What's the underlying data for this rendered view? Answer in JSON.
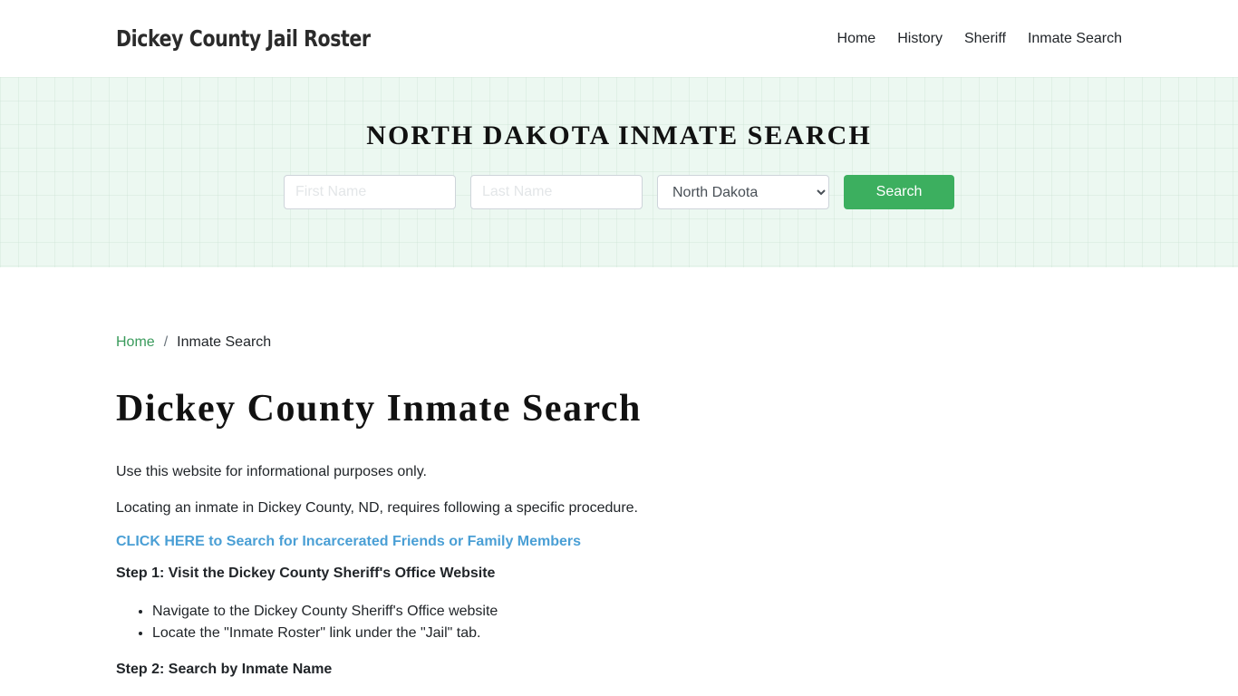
{
  "header": {
    "brand": "Dickey County Jail Roster",
    "nav": [
      "Home",
      "History",
      "Sheriff",
      "Inmate Search"
    ]
  },
  "banner": {
    "title": "NORTH DAKOTA INMATE SEARCH",
    "first_name_placeholder": "First Name",
    "last_name_placeholder": "Last Name",
    "state_selected": "North Dakota",
    "search_label": "Search",
    "accent_color": "#3caf5f"
  },
  "breadcrumb": {
    "home": "Home",
    "separator": "/",
    "current": "Inmate Search"
  },
  "main": {
    "title": "Dickey County Inmate Search",
    "paragraphs": [
      "Use this website for informational purposes only.",
      "Locating an inmate in Dickey County, ND, requires following a specific procedure."
    ],
    "cta_link": "CLICK HERE to Search for Incarcerated Friends or Family Members",
    "step1_heading": "Step 1: Visit the Dickey County Sheriff's Office Website",
    "step1_items": [
      "Navigate to the Dickey County Sheriff's Office website",
      "Locate the \"Inmate Roster\" link under the \"Jail\" tab."
    ],
    "step2_heading": "Step 2: Search by Inmate Name"
  }
}
